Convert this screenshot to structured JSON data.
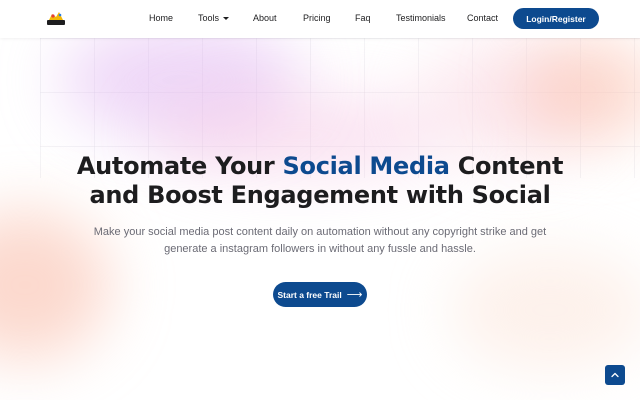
{
  "nav": {
    "items": [
      {
        "label": "Home"
      },
      {
        "label": "Tools"
      },
      {
        "label": "About"
      },
      {
        "label": "Pricing"
      },
      {
        "label": "Faq"
      },
      {
        "label": "Testimonials"
      },
      {
        "label": "Contact"
      }
    ],
    "login_label": "Login/Register"
  },
  "hero": {
    "headline_part1": "Automate Your ",
    "headline_accent": "Social Media",
    "headline_part2": " Content",
    "headline_line2": "and Boost Engagement with Social",
    "subtitle": "Make your social media post content daily on automation without any copyright strike and get generate a instagram followers in without any fussle and hassle.",
    "cta_label": "Start a free Trail",
    "cta_arrow": "⟶"
  },
  "icons": {
    "logo": "brand-logo-icon",
    "tools_dropdown": "caret-down-icon",
    "scroll_top": "chevron-up-icon"
  },
  "colors": {
    "primary": "#0d4a8f",
    "text": "#1d1d1f",
    "muted": "#6b6b75"
  }
}
